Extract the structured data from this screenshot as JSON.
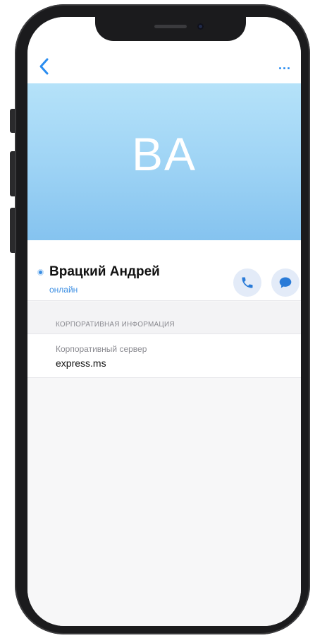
{
  "colors": {
    "accent": "#2a8df0",
    "header_gradient_top": "#b5e2f9",
    "header_gradient_bottom": "#85c3ef",
    "action_button_bg": "#e3ebf8",
    "online_status": "#3b8ee3"
  },
  "navbar": {
    "back_icon": "chevron-left-icon",
    "more_icon": "ellipsis-icon",
    "more_label": "..."
  },
  "profile": {
    "initials": "BA",
    "name": "Врацкий Андрей",
    "status": "онлайн",
    "call_icon": "phone-icon",
    "chat_icon": "chat-bubble-icon"
  },
  "corporate_section": {
    "title": "КОРПОРАТИВНАЯ ИНФОРМАЦИЯ",
    "fields": [
      {
        "label": "Корпоративный сервер",
        "value": "express.ms"
      }
    ]
  }
}
